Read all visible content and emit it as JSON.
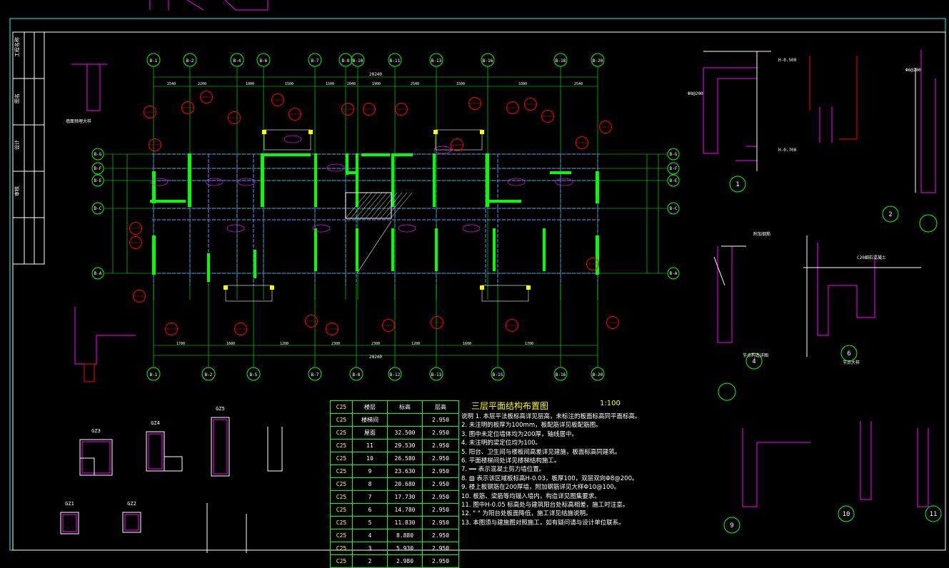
{
  "drawing": {
    "title": "三层平面结构布置图",
    "scale": "1:100",
    "colors": {
      "axis": "#00ff00",
      "wall": "#00ff00",
      "beam": "#4a7fd6",
      "rebar": "#ff00ff",
      "marker": "#ff0000",
      "text": "#ffffff",
      "highlight": "#ffff00"
    }
  },
  "axes": {
    "top": [
      "B-1",
      "B-2",
      "B-4",
      "B-6",
      "B-7",
      "B-8",
      "B-10",
      "B-11",
      "B-13",
      "B-16",
      "B-18",
      "B-20"
    ],
    "bottom": [
      "B-1",
      "B-2",
      "B-5",
      "B-7",
      "B-8",
      "B-12",
      "B-13",
      "B-15",
      "B-16",
      "B-20"
    ],
    "left": [
      "B-G",
      "B-F",
      "B-E",
      "B-C",
      "B-A"
    ],
    "right": [
      "B-G",
      "B-F",
      "B-E",
      "B-C",
      "B-A"
    ]
  },
  "dims": {
    "top_total": "20240",
    "top_segments": [
      "2540",
      "2200",
      "1000",
      "1500",
      "1500",
      "2040",
      "1900",
      "2540",
      "1500",
      "3300",
      "2540"
    ],
    "bottom_total": "20240",
    "bottom_segments": [
      "1700",
      "1600",
      "1200",
      "2300",
      "2300",
      "1200",
      "1600",
      "1700"
    ]
  },
  "levels": {
    "headers": [
      "C25",
      "楼层",
      "标高",
      "层高"
    ],
    "rows": [
      [
        "C25",
        "楼梯间",
        "",
        "2.950"
      ],
      [
        "C25",
        "屋面",
        "32.500",
        "2.950"
      ],
      [
        "C25",
        "11",
        "29.530",
        "2.950"
      ],
      [
        "C25",
        "10",
        "26.580",
        "2.950"
      ],
      [
        "C25",
        "9",
        "23.630",
        "2.950"
      ],
      [
        "C25",
        "8",
        "20.680",
        "2.950"
      ],
      [
        "C25",
        "7",
        "17.730",
        "2.950"
      ],
      [
        "C25",
        "6",
        "14.780",
        "2.950"
      ],
      [
        "C25",
        "5",
        "11.830",
        "2.950"
      ],
      [
        "C25",
        "4",
        "8.880",
        "2.950"
      ],
      [
        "C25",
        "3",
        "5.930",
        "2.950"
      ],
      [
        "C25",
        "2",
        "2.980",
        "2.950"
      ]
    ]
  },
  "notes": [
    "说明 1. 本层平法板标高详见层高，未标注的板面标高同平面标高。",
    "2. 未注明的板厚为100mm，板配筋详见板配筋图。",
    "3. 图中未定位墙体均为200厚，轴线居中。",
    "4. 未注明的梁定位均为100。",
    "5. 阳台、卫生间与楼板间高差详见建施，板面标高同建筑。",
    "6. 平面楼梯间处详见楼梯结构施工。",
    "7. ━━ 表示混凝土剪力墙位置。",
    "8. ▨ 表示该区域板标高H-0.03，板厚100，双层双向Φ8@200。",
    "9. 楼上板钢筋在200厚墙，附加钢筋详见大样Φ10@100。",
    "10. 板筋、梁筋等均锚入墙内，构造详见图集要求。",
    "11. 图中H-0.05 标高处与建筑阳台处标高相差，施工时注意。",
    "12. \"  \" 为阳台处板面降低，施工详见结施说明。",
    "13. 本图须与建施图对照施工，如有疑问请与设计单位联系。"
  ],
  "details": {
    "detail_labels": [
      "1",
      "2",
      "4",
      "6",
      "9",
      "10",
      "11"
    ],
    "column_labels": [
      "GZ3",
      "GZ4",
      "GZ5",
      "GZ1",
      "GZ2"
    ],
    "notes": [
      "墙面预埋大样",
      "节点构造详图",
      "节点大样",
      "附加钢筋",
      "C20细石混凝土",
      "H-0.500",
      "H-0.700",
      "Φ8@200",
      "Φ6@200"
    ]
  },
  "title_block": {
    "rows": [
      "工程名称",
      "图名",
      "设计",
      "审核"
    ]
  }
}
